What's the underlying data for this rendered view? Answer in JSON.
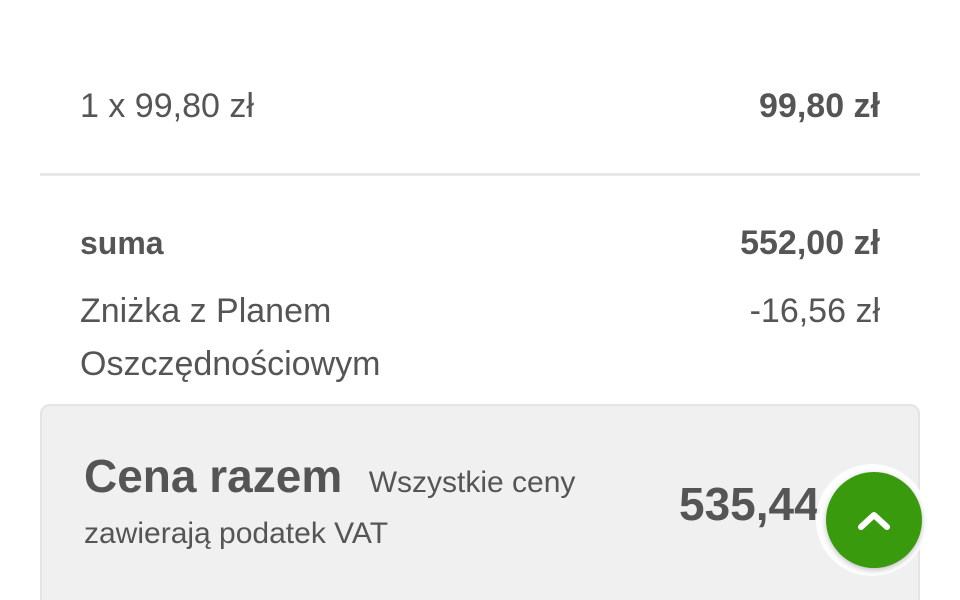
{
  "item_line": {
    "quantity_price": "1 x 99,80 zł",
    "line_total": "99,80 zł"
  },
  "summary": {
    "sum_label": "suma",
    "sum_value": "552,00 zł",
    "discount_label_line1": "Zniżka z Planem",
    "discount_label_line2": "Oszczędnościowym",
    "discount_value": "-16,56 zł"
  },
  "total": {
    "title": "Cena razem",
    "note_part1": "Wszystkie ceny",
    "note_part2": "zawierają podatek VAT",
    "value": "535,44"
  },
  "scroll_top": {
    "icon": "chevron-up-icon",
    "color": "#3a9a0e"
  }
}
